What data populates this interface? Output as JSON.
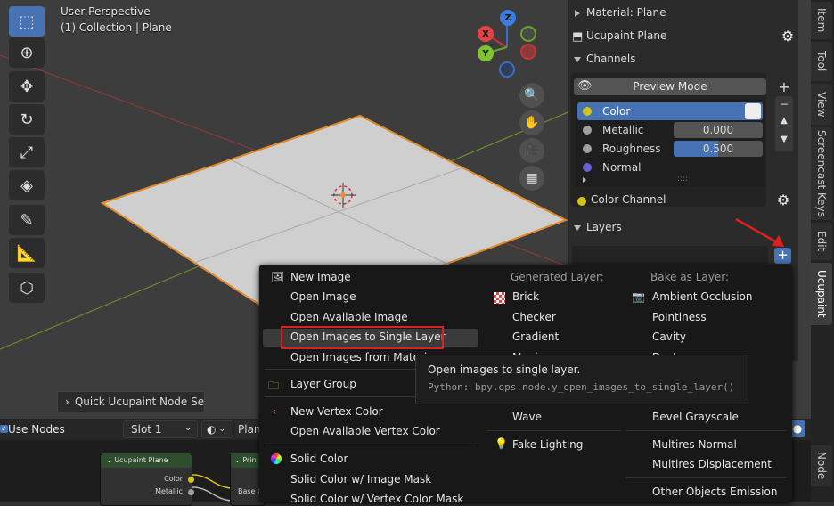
{
  "viewport": {
    "perspective_label": "User Perspective",
    "collection_label": "(1) Collection | Plane",
    "gizmo": {
      "z": "Z",
      "x": "X",
      "y": "Y"
    },
    "quick_setup_label": "Quick Ucupaint Node Setu",
    "tools": [
      "select-box-icon",
      "cursor-icon",
      "move-icon",
      "rotate-icon",
      "scale-icon",
      "transform-icon",
      "annotate-icon",
      "measure-icon",
      "add-cube-icon"
    ]
  },
  "npanel": {
    "material_label": "Material: Plane",
    "ucupaint_label": "Ucupaint Plane",
    "channels_label": "Channels",
    "preview_mode_label": "Preview Mode",
    "channels": [
      {
        "name": "Color",
        "value": "",
        "dot": "#d4c416",
        "selected": true
      },
      {
        "name": "Metallic",
        "value": "0.000",
        "dot": "#a0a0a0",
        "selected": false
      },
      {
        "name": "Roughness",
        "value": "0.500",
        "dot": "#a0a0a0",
        "selected": false
      },
      {
        "name": "Normal",
        "value": "",
        "dot": "#6a5fd6",
        "selected": false
      }
    ],
    "dots_label": "::::",
    "color_channel_label": "Color Channel",
    "layers_label": "Layers"
  },
  "vtabs": [
    "Item",
    "Tool",
    "View",
    "Screencast Keys",
    "Edit",
    "Ucupaint",
    "Node"
  ],
  "menu": {
    "col1": [
      {
        "label": "New Image",
        "icon": "image-icon"
      },
      {
        "label": "Open Image"
      },
      {
        "label": "Open Available Image"
      },
      {
        "label": "Open Images to Single Layer",
        "highlight": true
      },
      {
        "label": "Open Images from Materia"
      },
      {
        "label": "Layer Group",
        "icon": "folder-icon"
      },
      {
        "label": "New Vertex Color",
        "icon": "vertex-color-icon"
      },
      {
        "label": "Open Available Vertex Color"
      },
      {
        "label": "Solid Color",
        "icon": "color-wheel-icon"
      },
      {
        "label": "Solid Color w/ Image Mask"
      },
      {
        "label": "Solid Color w/ Vertex Color Mask"
      }
    ],
    "col2_header": "Generated Layer:",
    "col2": [
      "Brick",
      "Checker",
      "Gradient",
      "Magic",
      "Wave",
      "Fake Lighting"
    ],
    "col3_header": "Bake as Layer:",
    "col3": [
      "Ambient Occlusion",
      "Pointiness",
      "Cavity",
      "Dust",
      "Bevel Grayscale",
      "Multires Normal",
      "Multires Displacement",
      "Other Objects Emission"
    ]
  },
  "tooltip": {
    "title": "Open images to single layer.",
    "python": "Python: bpy.ops.node.y_open_images_to_single_layer()"
  },
  "node_editor": {
    "use_nodes_label": "Use Nodes",
    "slot_label": "Slot 1",
    "plane_label": "Plan",
    "node1_title": "Ucupaint Plane",
    "node1_sockets": [
      "Color",
      "Metallic"
    ],
    "node2_title": "Prin",
    "node2_socket": "Base C"
  }
}
